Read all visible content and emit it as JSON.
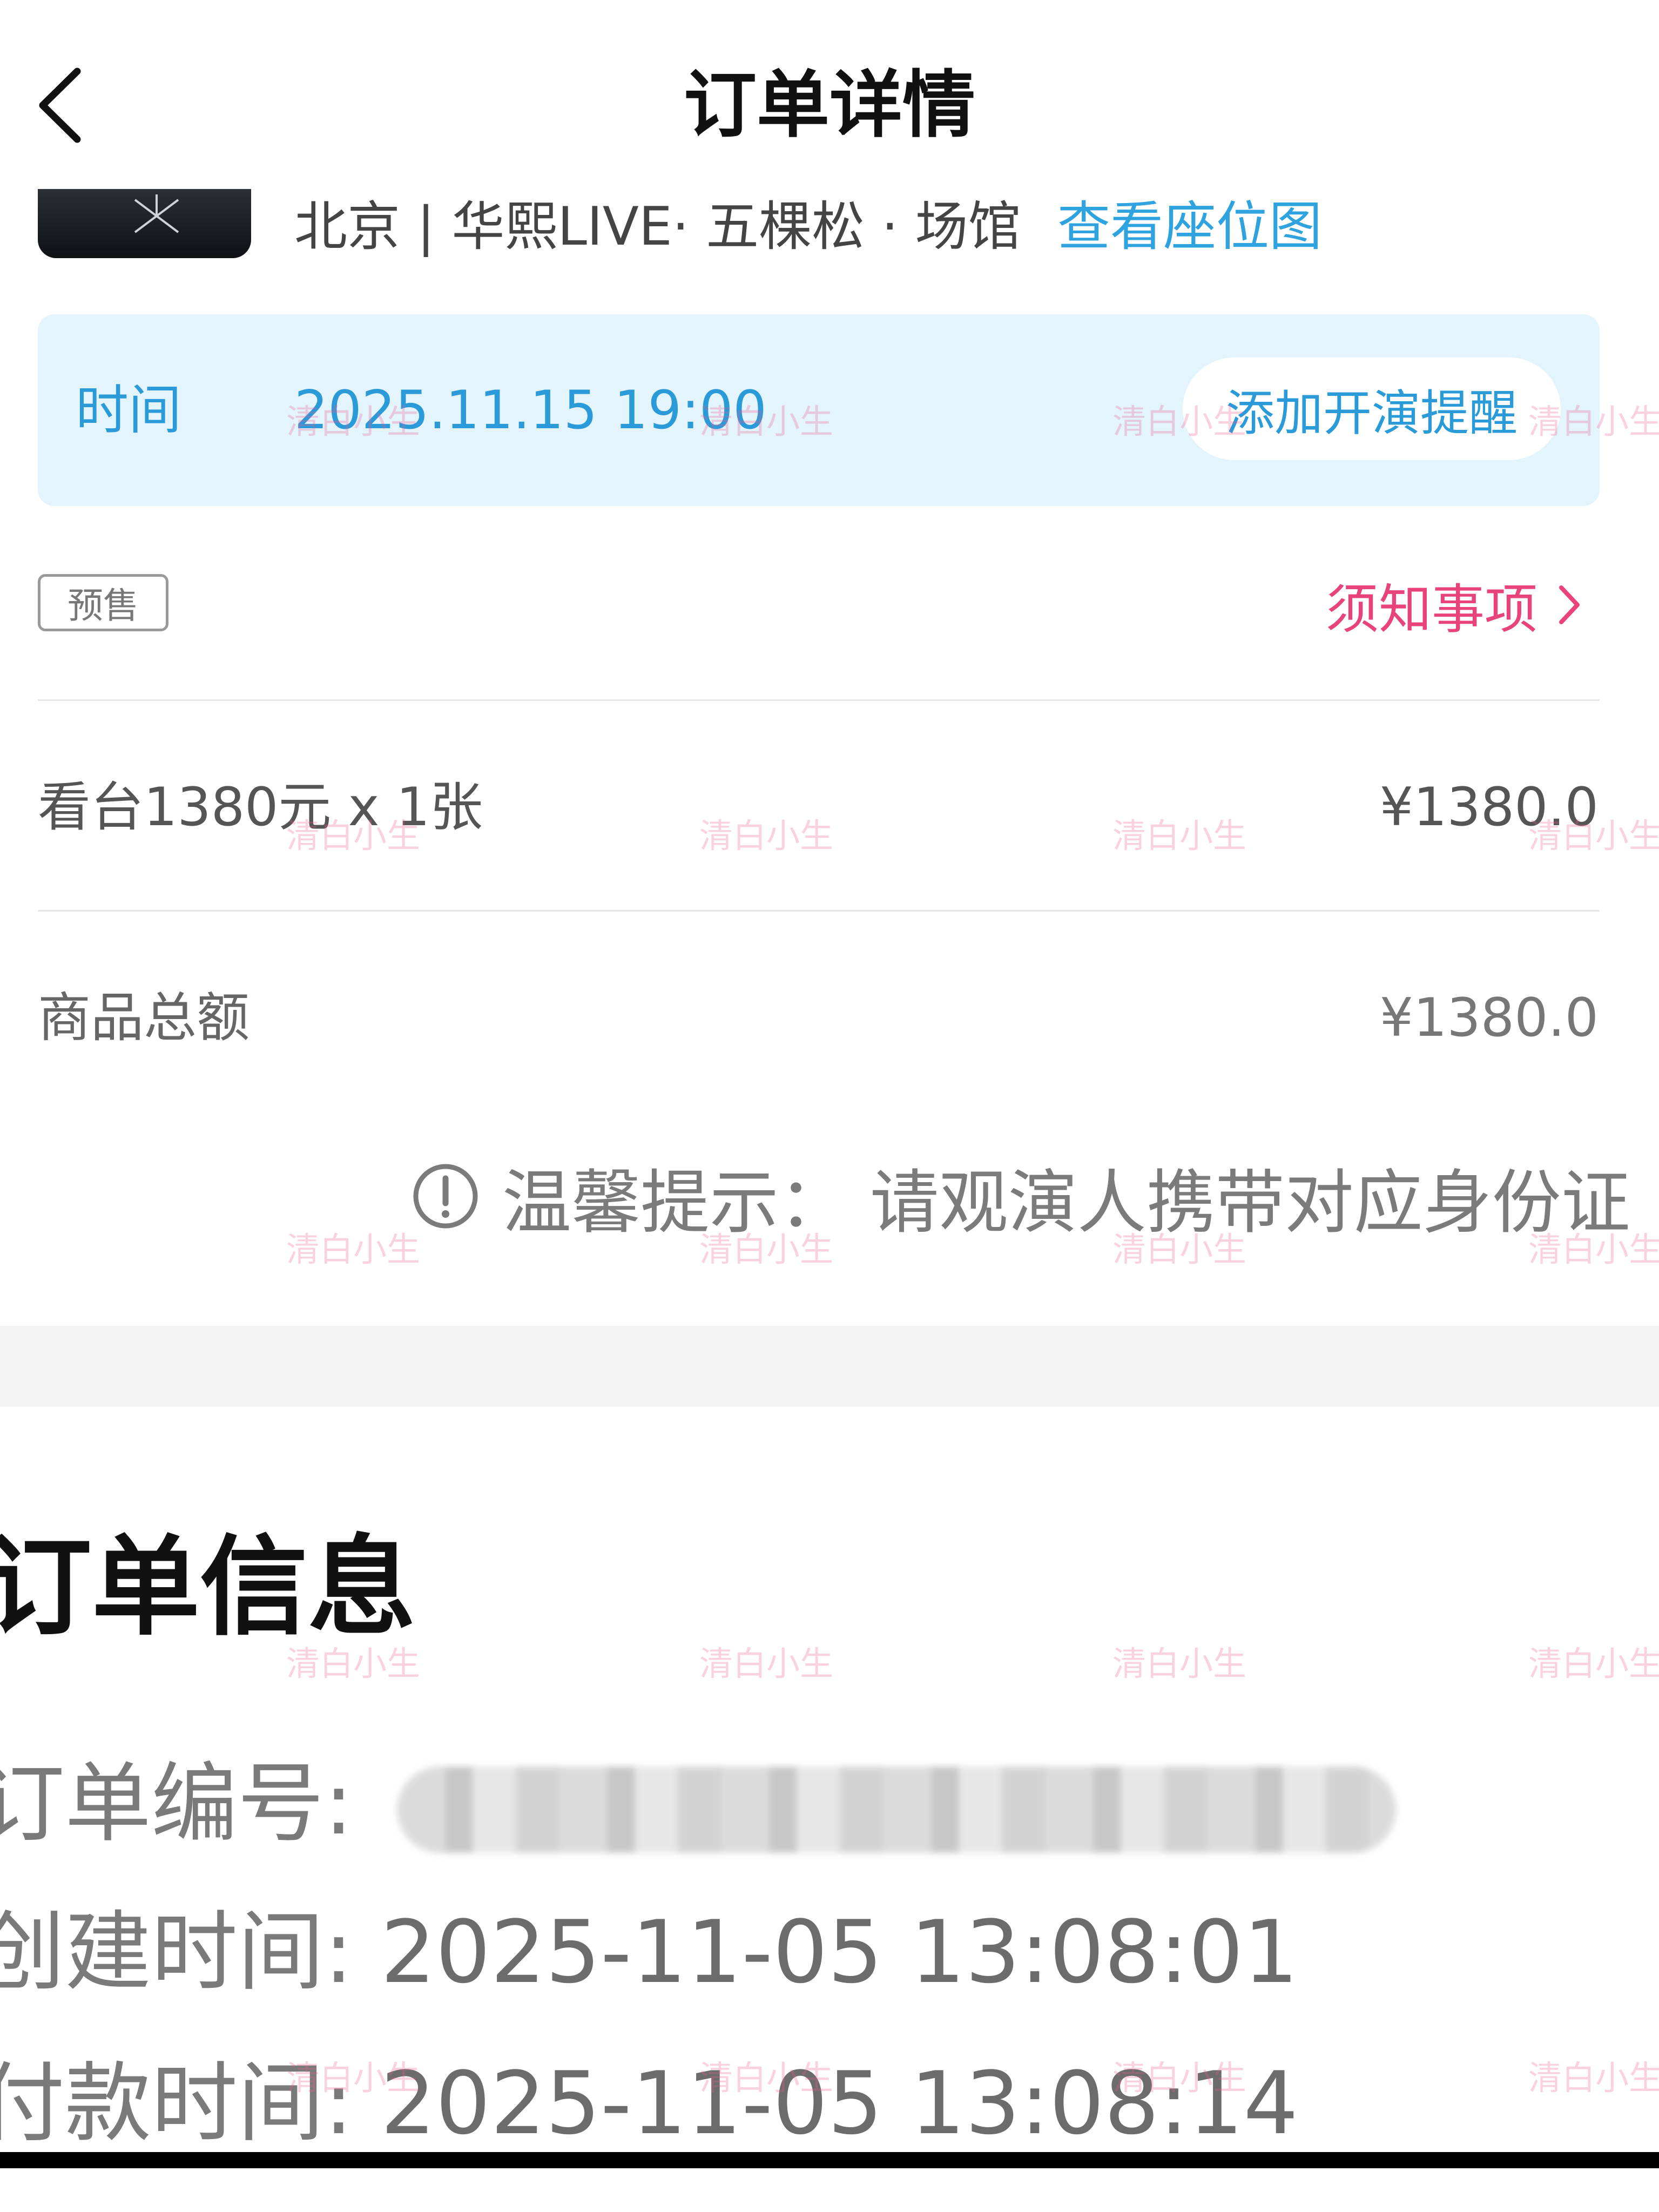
{
  "header": {
    "title": "订单详情",
    "back_icon": "chevron-left-icon"
  },
  "event": {
    "venue": "北京 | 华熙LIVE· 五棵松 · 场馆",
    "seat_map_link": "查看座位图",
    "time_label": "时间",
    "time_value": "2025.11.15 19:00",
    "reminder_button": "添加开演提醒"
  },
  "presale_badge": "预售",
  "notice_link": "须知事项",
  "ticket": {
    "description": "看台1380元 x 1张",
    "price": "¥1380.0"
  },
  "total": {
    "label": "商品总额",
    "value": "¥1380.0"
  },
  "tip": {
    "text": "温馨提示：  请观演人携带对应身份证",
    "icon": "info-circle-icon"
  },
  "order_info": {
    "title": "订单信息",
    "number_label": "订单编号: ",
    "created_label": "创建时间: ",
    "created_value": "2025-11-05 13:08:01",
    "paid_label": "付款时间: ",
    "paid_value": "2025-11-05 13:08:14"
  },
  "watermark": "清白小生",
  "colors": {
    "accent_blue": "#2b9ad8",
    "banner_bg": "#e3f4fd",
    "notice_pink": "#e8437a",
    "watermark": "#ec5a8c"
  }
}
